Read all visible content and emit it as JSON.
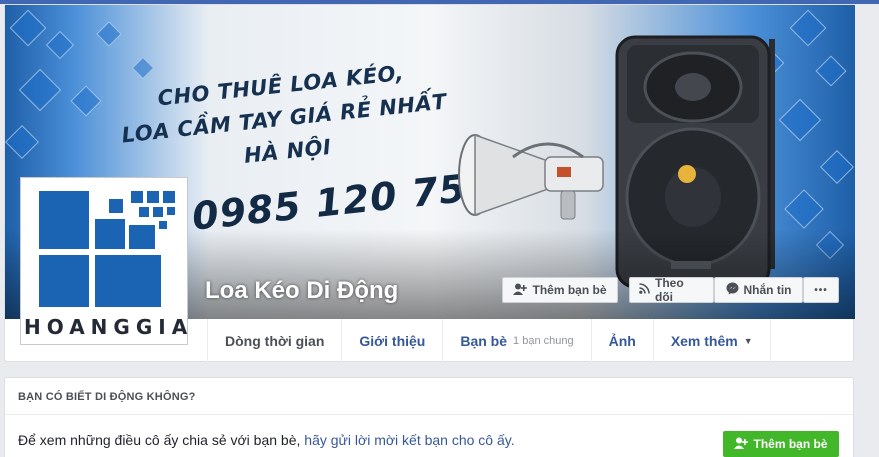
{
  "cover": {
    "headline_line1": "CHO THUÊ LOA KÉO,",
    "headline_line2": "LOA CẦM TAY GIÁ RẺ NHẤT HÀ NỘI",
    "phone": "0985 120 759"
  },
  "avatar": {
    "logo_text": "HOANGGIA"
  },
  "page_name": "Loa Kéo Di Động",
  "actions": {
    "add_friend": "Thêm bạn bè",
    "follow": "Theo dõi",
    "message": "Nhắn tin",
    "more": "•••"
  },
  "tabs": [
    {
      "label": "Dòng thời gian",
      "active": true
    },
    {
      "label": "Giới thiệu"
    },
    {
      "label": "Bạn bè",
      "sub": "1 bạn chung"
    },
    {
      "label": "Ảnh"
    },
    {
      "label": "Xem thêm"
    }
  ],
  "know_card": {
    "title": "BẠN CÓ BIẾT DI ĐỘNG KHÔNG?",
    "text_prefix": "Để xem những điều cô ấy chia sẻ với bạn bè, ",
    "text_link": "hãy gửi lời mời kết bạn cho cô ấy.",
    "button": "Thêm bạn bè"
  },
  "colors": {
    "brand_blue": "#4267b2",
    "link": "#365899",
    "green": "#42b72a",
    "logo_blue": "#1b63b3"
  },
  "icons": [
    "add-friend-icon",
    "rss-icon",
    "messenger-icon",
    "more-icon",
    "caret-down-icon"
  ]
}
